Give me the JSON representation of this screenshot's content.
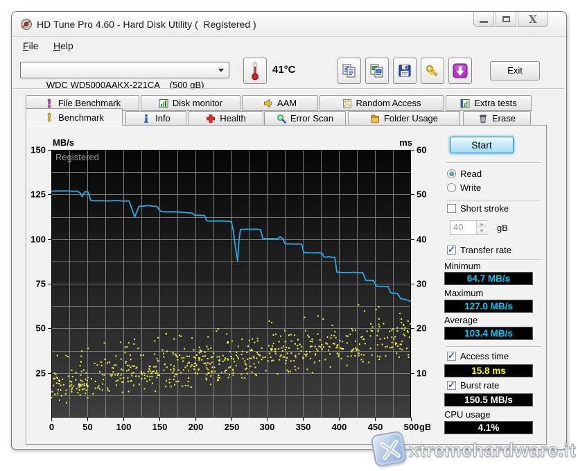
{
  "window": {
    "title": "HD Tune Pro 4.60 - Hard Disk Utility (  Registered )",
    "controls": {
      "minimize": "minimize",
      "maximize": "maximize",
      "close": "close"
    }
  },
  "menu": {
    "items": [
      {
        "label": "File"
      },
      {
        "label": "Help"
      }
    ]
  },
  "toolbar": {
    "drive_selector": {
      "value": "WDC WD5000AAKX-221CA    (500 gB)"
    },
    "temperature": {
      "value": "41°C",
      "icon": "thermometer-icon"
    },
    "buttons": [
      {
        "name": "copy-text",
        "icon": "copy-text-icon"
      },
      {
        "name": "copy-image",
        "icon": "copy-image-icon"
      },
      {
        "name": "save-screenshot",
        "icon": "floppy-save-icon"
      },
      {
        "name": "registration",
        "icon": "gold-keys-icon"
      },
      {
        "name": "check-update",
        "icon": "purple-download-arrow-icon"
      }
    ],
    "exit_label": "Exit"
  },
  "tabs": {
    "active": "Benchmark",
    "row1": [
      {
        "label": "File Benchmark",
        "icon": "exclamation-magenta-icon"
      },
      {
        "label": "Disk monitor",
        "icon": "bar-chart-icon"
      },
      {
        "label": "AAM",
        "icon": "speaker-icon"
      },
      {
        "label": "Random Access",
        "icon": "dotted-square-icon"
      },
      {
        "label": "Extra tests",
        "icon": "mini-chart-icon"
      }
    ],
    "row2": [
      {
        "label": "Benchmark",
        "icon": "exclamation-yellow-icon",
        "active": true
      },
      {
        "label": "Info",
        "icon": "info-icon"
      },
      {
        "label": "Health",
        "icon": "red-cross-icon"
      },
      {
        "label": "Error Scan",
        "icon": "magnifier-icon"
      },
      {
        "label": "Folder Usage",
        "icon": "folder-icon"
      },
      {
        "label": "Erase",
        "icon": "trash-icon"
      }
    ]
  },
  "chart_data": {
    "type": "line",
    "overlay_text": "Registered",
    "background": {
      "top": "#060606",
      "bottom": "#3e3e3e",
      "grid": "#7c7c7c"
    },
    "x_axis": {
      "unit": "gB",
      "range": [
        0,
        500
      ],
      "ticks": [
        0,
        50,
        100,
        150,
        200,
        250,
        300,
        350,
        400,
        450,
        500
      ],
      "minor_step": 25
    },
    "left_axis": {
      "unit": "MB/s",
      "range": [
        0,
        150
      ],
      "ticks": [
        150,
        125,
        100,
        75,
        50,
        25
      ],
      "minor_step": 12.5
    },
    "right_axis": {
      "unit": "ms",
      "range": [
        0,
        60
      ],
      "ticks": [
        60,
        50,
        40,
        30,
        20,
        10
      ]
    },
    "series": [
      {
        "name": "Transfer rate",
        "type": "line",
        "axis": "left",
        "color": "#2aa9e8",
        "x": [
          0,
          8,
          16,
          24,
          30,
          36,
          40,
          43,
          45,
          47,
          51,
          53,
          55,
          62,
          70,
          80,
          90,
          100,
          108,
          112,
          116,
          119,
          122,
          128,
          135,
          141,
          147,
          150,
          153,
          160,
          170,
          180,
          190,
          196,
          199,
          207,
          213,
          216,
          225,
          235,
          245,
          250,
          253,
          256,
          259,
          261,
          263,
          270,
          277,
          285,
          291,
          294,
          300,
          307,
          314,
          318,
          322,
          325,
          332,
          340,
          348,
          351,
          358,
          365,
          371,
          376,
          379,
          383,
          386,
          390,
          394,
          397,
          404,
          412,
          420,
          428,
          433,
          437,
          443,
          448,
          452,
          458,
          464,
          468,
          472,
          476,
          481,
          486,
          491,
          495,
          498,
          500
        ],
        "y": [
          126.8,
          127,
          126.9,
          127,
          126.8,
          126.9,
          126,
          123.8,
          125.5,
          126.6,
          126.4,
          124,
          121.6,
          121.4,
          121.5,
          121.4,
          121.6,
          121.3,
          121.4,
          117,
          112.4,
          115.5,
          118.4,
          118.5,
          118.8,
          118.4,
          118.3,
          116.5,
          115.4,
          115.2,
          115.3,
          115.1,
          114.7,
          114.6,
          113.4,
          113.3,
          113.2,
          110.2,
          110.1,
          110.2,
          110,
          109.9,
          105,
          95,
          87.8,
          100,
          105.4,
          105.6,
          105.5,
          105.6,
          105.3,
          100.3,
          100.2,
          100.3,
          100.1,
          101.3,
          100.2,
          97.4,
          97.3,
          97.2,
          97.3,
          92.5,
          92.4,
          92.3,
          92.4,
          92.2,
          90.1,
          89.8,
          90.3,
          89.7,
          89.9,
          81.5,
          81.3,
          81.2,
          81.4,
          81.1,
          81.2,
          76.9,
          76.8,
          76.7,
          73.6,
          73.5,
          73.4,
          73.5,
          69.8,
          69.7,
          69.6,
          66.5,
          66.3,
          65.8,
          65.3,
          65.1
        ]
      },
      {
        "name": "Access time",
        "type": "scatter",
        "axis": "right",
        "color": "#f4f44c",
        "generator": {
          "seed": 1337,
          "count": 640,
          "start_min_ms": 2.5,
          "start_max_ms": 12.5,
          "end_min_ms": 12.5,
          "end_max_ms": 24.5,
          "outlier_rate": 0.05,
          "outlier_extra_ms": 2.5
        }
      }
    ]
  },
  "panel": {
    "start_label": "Start",
    "read": {
      "label": "Read",
      "selected": true
    },
    "write": {
      "label": "Write",
      "selected": false
    },
    "short_stroke": {
      "label": "Short stroke",
      "checked": false
    },
    "capacity_spinner": {
      "value": "40",
      "unit": "gB",
      "enabled": false
    },
    "transfer_rate": {
      "label": "Transfer rate",
      "checked": true
    },
    "minimum": {
      "label": "Minimum",
      "value": "64.7 MB/s",
      "color": "#00c8f8"
    },
    "maximum": {
      "label": "Maximum",
      "value": "127.0 MB/s",
      "color": "#00c8f8"
    },
    "average": {
      "label": "Average",
      "value": "103.4 MB/s",
      "color": "#00c8f8"
    },
    "access_time": {
      "label": "Access time",
      "checked": true,
      "value": "15.8 ms",
      "color": "#f8f800"
    },
    "burst_rate": {
      "label": "Burst rate",
      "checked": true,
      "value": "150.5 MB/s",
      "color": "#ffffff"
    },
    "cpu_usage": {
      "label": "CPU usage",
      "value": "4.1%",
      "color": "#ffffff"
    }
  },
  "watermark": {
    "text": "xtremehardware.it",
    "logo": "x-logo-icon"
  }
}
